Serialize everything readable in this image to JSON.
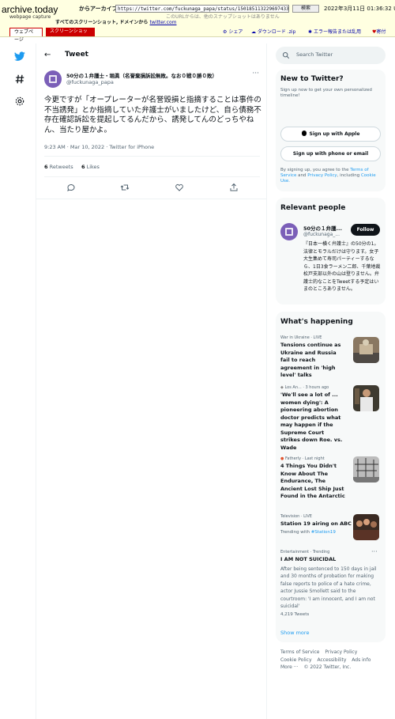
{
  "archive": {
    "logo": "archive.today",
    "logo_sub": "webpage capture",
    "from_label": "からアーカイブ",
    "url": "https://twitter.com/fuckunaga_papa/status/1501851132296974338",
    "search_label": "検索",
    "date": "2022年3月11日 01:36:32 UTC",
    "no_snapshots": "このURLからは、他のスナップショットはありません",
    "screenshots_text": "すべてのスクリーンショット, ドメインから",
    "screenshots_link": "twitter.com",
    "tab_web": "ウェブページ",
    "tab_screenshot": "スクリーンショット",
    "tools": {
      "share": "シェア",
      "download": "ダウンロード .zip",
      "report": "エラー報告または乱用",
      "donate": "寄付"
    }
  },
  "header": {
    "title": "Tweet"
  },
  "tweet": {
    "name": "50分の１弁護士・堀眞（名誉棄損訴訟無敗。なお０戦０勝０敗）",
    "handle": "@fuckunaga_papa",
    "text": "今更ですが「オープレーターが名誉毀損と指摘することは事件の不当誘発」とか指摘していた弁護士がいましたけど、自ら債務不存在確認訴訟を提起してるんだから、誘発してんのどっちやねん、当たり屋かよ。",
    "timestamp": "9:23 AM · Mar 10, 2022 · Twitter for iPhone",
    "retweets_count": "6",
    "retweets_label": "Retweets",
    "likes_count": "6",
    "likes_label": "Likes"
  },
  "search": {
    "placeholder": "Search Twitter"
  },
  "new_to_twitter": {
    "title": "New to Twitter?",
    "subtitle": "Sign up now to get your own personalized timeline!",
    "apple_button": "Sign up with Apple",
    "phone_button": "Sign up with phone or email",
    "terms_pre": "By signing up, you agree to the",
    "terms_link": "Terms of Service",
    "terms_and": "and",
    "privacy_link": "Privacy Policy",
    "terms_mid": ", including",
    "cookie_link": "Cookie Use."
  },
  "relevant": {
    "title": "Relevant people",
    "name": "50分の１弁護...",
    "handle": "@fuckunaga_...",
    "follow": "Follow",
    "bio": "『日本一横く弁護士』の50分の1。法律とモラルだけは守ります。女子大生集めて寿司パーティーするなら、1日3食ラーメン二郎、千葉地裁松戸支部以外の山は登りません。弁護士的なことをTweetする予定はいまのところありません。"
  },
  "happening": {
    "title": "What's happening",
    "trends": [
      {
        "meta": "War in Ukraine · LIVE",
        "title": "Tensions continue as Ukraine and Russia fail to reach agreement in 'high level' talks",
        "sub": "",
        "hash": ""
      },
      {
        "meta": "Los An... · 3 hours ago",
        "title": "'We'll see a lot of ... women dying': A pioneering abortion doctor predicts what may happen if the Supreme Court strikes down Roe. vs. Wade",
        "sub": "",
        "hash": ""
      },
      {
        "meta": "Fatherly · Last night",
        "title": "4 Things You Didn't Know About The Endurance, The Ancient Lost Ship Just Found in the Antarctic",
        "sub": "",
        "hash": ""
      },
      {
        "meta": "Television · LIVE",
        "title": "Station 19 airing on ABC",
        "sub": "Trending with",
        "hash": "#Station19"
      },
      {
        "meta": "Entertainment · Trending",
        "title": "I AM NOT SUICIDAL",
        "sub": "After being sentenced to 150 days in jail and 30 months of probation for making false reports to police of a hate crime, actor Jussie Smollett said to the courtroom: 'I am innocent, and I am not suicidal'",
        "hash": "",
        "count": "4,219 Tweets"
      }
    ],
    "show_more": "Show more"
  },
  "footer": {
    "links": [
      "Terms of Service",
      "Privacy Policy",
      "Cookie Policy",
      "Accessibility",
      "Ads info",
      "More ···"
    ],
    "copyright": "© 2022 Twitter, Inc."
  },
  "colors": {
    "accent": "#1d9bf0",
    "archive_bg": "#ffffe1",
    "archive_red": "#cc0000",
    "avatar": "#7b5fb8"
  }
}
